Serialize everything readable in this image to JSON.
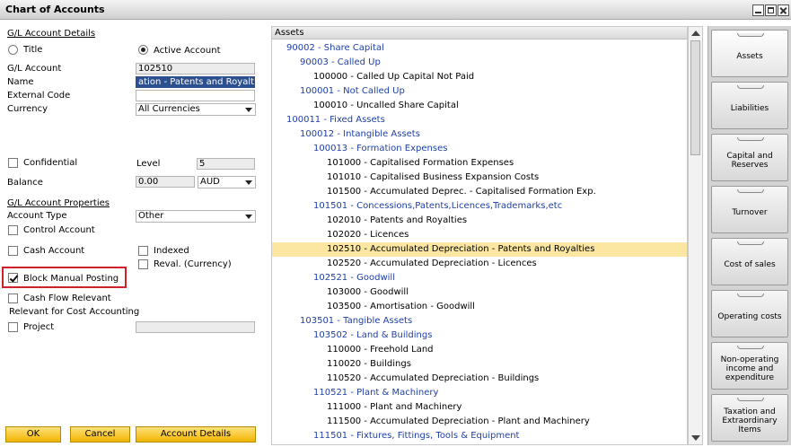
{
  "window": {
    "title": "Chart of Accounts"
  },
  "left": {
    "gl_details": "G/L Account Details",
    "title_radio": "Title",
    "active_radio": "Active Account",
    "gl_account_label": "G/L Account",
    "gl_account_value": "102510",
    "name_label": "Name",
    "name_value": "ation - Patents and Royalties",
    "external_code_label": "External Code",
    "external_code_value": "",
    "currency_label": "Currency",
    "currency_value": "All Currencies",
    "confidential_label": "Confidential",
    "level_label": "Level",
    "level_value": "5",
    "balance_label": "Balance",
    "balance_value": "0.00",
    "balance_currency": "AUD",
    "gl_properties": "G/L Account Properties",
    "account_type_label": "Account Type",
    "account_type_value": "Other",
    "control_account": "Control Account",
    "cash_account": "Cash Account",
    "indexed": "Indexed",
    "reval": "Reval. (Currency)",
    "block_manual": "Block Manual Posting",
    "cash_flow": "Cash Flow Relevant",
    "cost_accounting": "Relevant for Cost Accounting",
    "project": "Project",
    "project_value": ""
  },
  "buttons": {
    "ok": "OK",
    "cancel": "Cancel",
    "details": "Account Details"
  },
  "tree": {
    "header": "Assets",
    "rows": [
      {
        "text": "90002 - Share Capital",
        "kind": "title",
        "level": 1
      },
      {
        "text": "90003 - Called Up",
        "kind": "title",
        "level": 2
      },
      {
        "text": "100000 - Called Up Capital Not Paid",
        "kind": "account",
        "level": 3
      },
      {
        "text": "100001 - Not Called Up",
        "kind": "title",
        "level": 2
      },
      {
        "text": "100010 - Uncalled Share Capital",
        "kind": "account",
        "level": 3
      },
      {
        "text": "100011 - Fixed Assets",
        "kind": "title",
        "level": 1
      },
      {
        "text": "100012 - Intangible Assets",
        "kind": "title",
        "level": 2
      },
      {
        "text": "100013 - Formation Expenses",
        "kind": "title",
        "level": 3
      },
      {
        "text": "101000 - Capitalised Formation Expenses",
        "kind": "account",
        "level": 4
      },
      {
        "text": "101010 - Capitalised Business Expansion Costs",
        "kind": "account",
        "level": 4
      },
      {
        "text": "101500 - Accumulated Deprec. - Capitalised Formation Exp.",
        "kind": "account",
        "level": 4
      },
      {
        "text": "101501 - Concessions,Patents,Licences,Trademarks,etc",
        "kind": "title",
        "level": 3
      },
      {
        "text": "102010 - Patents and Royalties",
        "kind": "account",
        "level": 4
      },
      {
        "text": "102020 - Licences",
        "kind": "account",
        "level": 4
      },
      {
        "text": "102510 - Accumulated Depreciation - Patents and Royalties",
        "kind": "account",
        "level": 4,
        "selected": true
      },
      {
        "text": "102520 - Accumulated Depreciation - Licences",
        "kind": "account",
        "level": 4
      },
      {
        "text": "102521 - Goodwill",
        "kind": "title",
        "level": 3
      },
      {
        "text": "103000 - Goodwill",
        "kind": "account",
        "level": 4
      },
      {
        "text": "103500 - Amortisation - Goodwill",
        "kind": "account",
        "level": 4
      },
      {
        "text": "103501 - Tangible Assets",
        "kind": "title",
        "level": 2
      },
      {
        "text": "103502 - Land & Buildings",
        "kind": "title",
        "level": 3
      },
      {
        "text": "110000 - Freehold Land",
        "kind": "account",
        "level": 4
      },
      {
        "text": "110020 - Buildings",
        "kind": "account",
        "level": 4
      },
      {
        "text": "110520 - Accumulated Depreciation - Buildings",
        "kind": "account",
        "level": 4
      },
      {
        "text": "110521 - Plant & Machinery",
        "kind": "title",
        "level": 3
      },
      {
        "text": "111000 - Plant and Machinery",
        "kind": "account",
        "level": 4
      },
      {
        "text": "111500 - Accumulated Depreciation - Plant and Machinery",
        "kind": "account",
        "level": 4
      },
      {
        "text": "111501 - Fixtures, Fittings, Tools & Equipment",
        "kind": "title",
        "level": 3
      }
    ]
  },
  "drawers": [
    {
      "label": "Assets",
      "active": true
    },
    {
      "label": "Liabilities"
    },
    {
      "label": "Capital and Reserves"
    },
    {
      "label": "Turnover"
    },
    {
      "label": "Cost of sales"
    },
    {
      "label": "Operating costs"
    },
    {
      "label": "Non-operating income and expenditure"
    },
    {
      "label": "Taxation and Extraordinary Items"
    }
  ]
}
